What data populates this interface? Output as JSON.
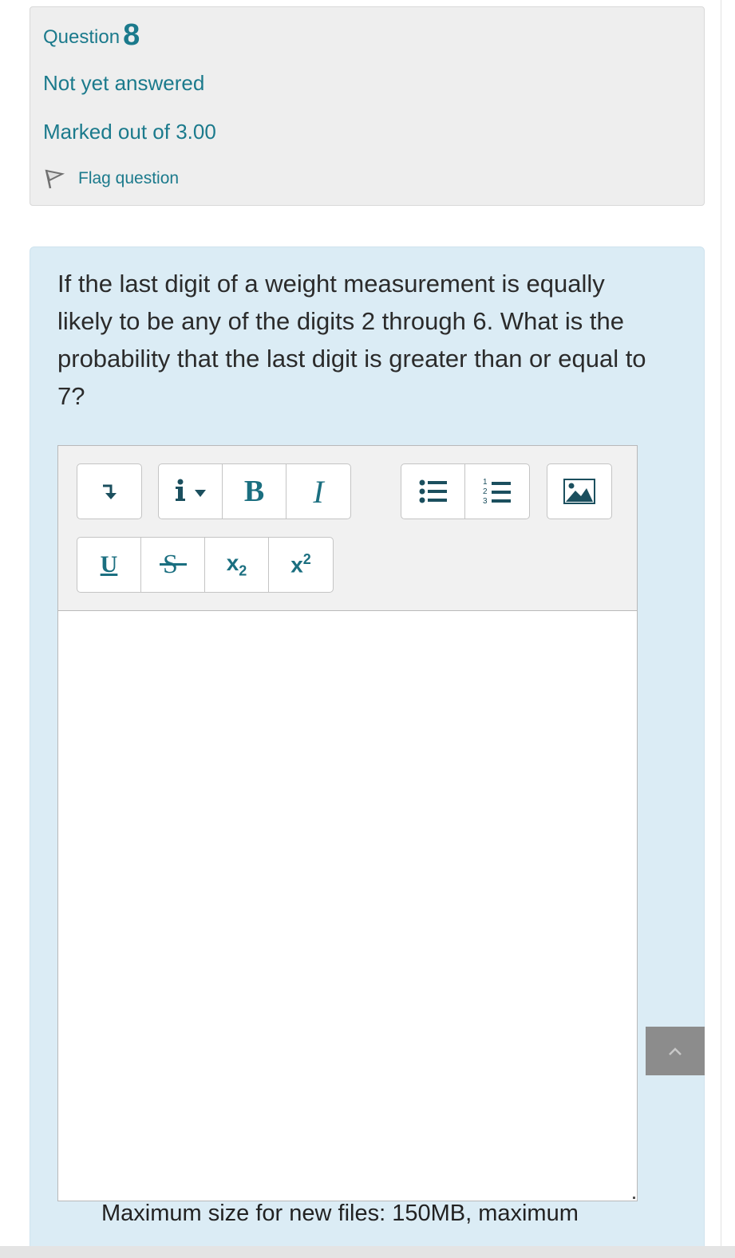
{
  "info": {
    "question_label": "Question",
    "question_number": "8",
    "state": "Not yet answered",
    "grade": "Marked out of 3.00",
    "flag_label": "Flag question"
  },
  "question": {
    "text": "If the last digit of a weight measurement is equally likely to be any of the digits 2 through 6. What is the probability that the last digit is greater than or equal to 7?"
  },
  "toolbar": {
    "bold_label": "B",
    "italic_label": "I",
    "underline_label": "U",
    "subscript_label": "x",
    "subscript_mark": "2",
    "superscript_label": "x",
    "superscript_mark": "2",
    "icons": [
      "collapse-icon",
      "info-dropdown-icon",
      "bold-icon",
      "italic-icon",
      "unordered-list-icon",
      "ordered-list-icon",
      "image-icon",
      "underline-icon",
      "strikethrough-icon",
      "subscript-icon",
      "superscript-icon"
    ]
  },
  "footer": {
    "max_size": "Maximum size for new files: 150MB, maximum"
  },
  "colors": {
    "accent": "#1b7a8c",
    "info_bg": "#eeeeee",
    "content_bg": "#dbecf5",
    "toolbar_bg": "#f1f1f1"
  }
}
